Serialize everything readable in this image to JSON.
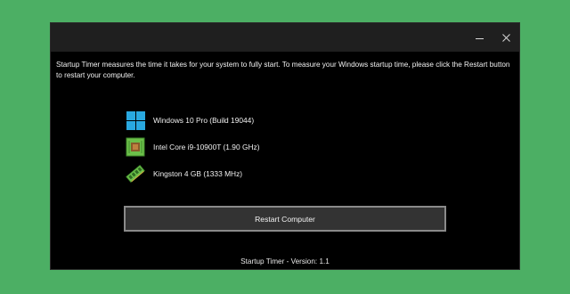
{
  "window": {
    "title": "",
    "minimize_symbol": "",
    "close_symbol": ""
  },
  "description": "Startup Timer measures the time it takes for your system to fully start. To measure your Windows startup time, please click the Restart button to restart your computer.",
  "system_info": [
    {
      "icon": "windows-logo-icon",
      "label": "Windows 10 Pro (Build 19044)"
    },
    {
      "icon": "cpu-chip-icon",
      "label": "Intel Core i9-10900T (1.90 GHz)"
    },
    {
      "icon": "ram-module-icon",
      "label": "Kingston 4 GB (1333 MHz)"
    }
  ],
  "restart_button": {
    "label": "Restart Computer"
  },
  "footer": {
    "text": "Startup Timer - Version: 1.1"
  },
  "colors": {
    "page_background": "#4caf64",
    "window_background": "#000000",
    "titlebar": "#1f1f1f",
    "button_fill": "#333333",
    "button_border": "#8a8a8a",
    "windows_logo": "#29a8e0",
    "chip_green": "#6cc04a"
  }
}
